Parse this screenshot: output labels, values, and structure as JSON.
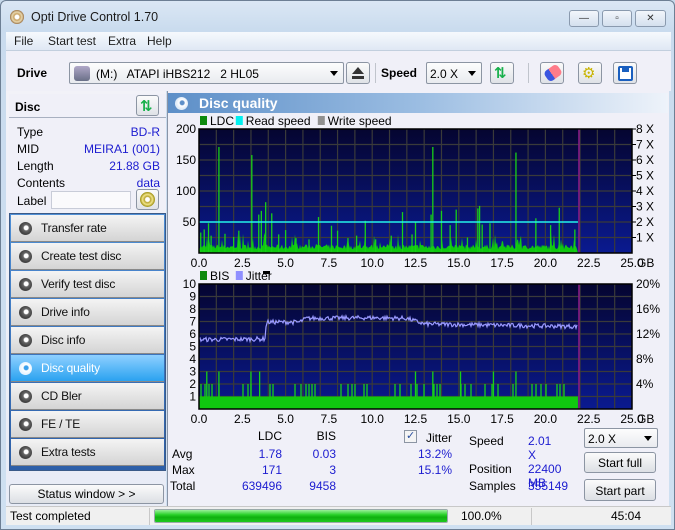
{
  "window": {
    "title": "Opti Drive Control 1.70",
    "controls": {
      "minimize": "—",
      "maximize": "▫",
      "close": "✕"
    }
  },
  "menu": [
    "File",
    "Start test",
    "Extra",
    "Help"
  ],
  "toolbar": {
    "drive_label": "Drive",
    "drive_value": "(M:)   ATAPI iHBS212   2 HL05",
    "speed_label": "Speed",
    "speed_value": "2.0 X"
  },
  "disc": {
    "header": "Disc",
    "fields": [
      {
        "key": "Type",
        "value": "BD-R"
      },
      {
        "key": "MID",
        "value": "MEIRA1 (001)"
      },
      {
        "key": "Length",
        "value": "21.88 GB"
      },
      {
        "key": "Contents",
        "value": "data"
      }
    ],
    "label_key": "Label",
    "label_value": ""
  },
  "nav": {
    "items": [
      {
        "label": "Transfer rate",
        "active": false
      },
      {
        "label": "Create test disc",
        "active": false
      },
      {
        "label": "Verify test disc",
        "active": false
      },
      {
        "label": "Drive info",
        "active": false
      },
      {
        "label": "Disc info",
        "active": false
      },
      {
        "label": "Disc quality",
        "active": true
      },
      {
        "label": "CD Bler",
        "active": false
      },
      {
        "label": "FE / TE",
        "active": false
      },
      {
        "label": "Extra tests",
        "active": false
      }
    ],
    "status_window_button": "Status window > >"
  },
  "panel": {
    "title": "Disc quality"
  },
  "chart_data": [
    {
      "type": "bar",
      "title": "LDC / Read speed",
      "legend": [
        {
          "name": "LDC",
          "color": "#0e8a0e"
        },
        {
          "name": "Read speed",
          "color": "#00f0f0"
        },
        {
          "name": "Write speed",
          "color": "#909090"
        }
      ],
      "xlabel": "GB",
      "x_ticks": [
        "0.0",
        "2.5",
        "5.0",
        "7.5",
        "10.0",
        "12.5",
        "15.0",
        "17.5",
        "20.0",
        "22.5",
        "25.0"
      ],
      "xlim": [
        0,
        25
      ],
      "ylim": [
        0,
        200
      ],
      "y_ticks": [
        "50",
        "100",
        "150",
        "200"
      ],
      "y2_ticks": [
        "1 X",
        "2 X",
        "3 X",
        "4 X",
        "5 X",
        "6 X",
        "7 X",
        "8 X"
      ],
      "y2lim": [
        0,
        8
      ],
      "data_end_gb": 21.88,
      "read_speed_x": 2.0,
      "ldc_spikes": [
        [
          0.1,
          33
        ],
        [
          0.3,
          38
        ],
        [
          0.55,
          48
        ],
        [
          0.7,
          28
        ],
        [
          1.15,
          171
        ],
        [
          1.5,
          31
        ],
        [
          2.0,
          26
        ],
        [
          2.3,
          36
        ],
        [
          3.05,
          158
        ],
        [
          3.45,
          62
        ],
        [
          3.6,
          68
        ],
        [
          3.85,
          82
        ],
        [
          4.2,
          64
        ],
        [
          4.6,
          30
        ],
        [
          5.0,
          37
        ],
        [
          5.6,
          24
        ],
        [
          6.35,
          22
        ],
        [
          6.9,
          58
        ],
        [
          7.65,
          44
        ],
        [
          8.0,
          36
        ],
        [
          8.6,
          24
        ],
        [
          9.1,
          28
        ],
        [
          9.6,
          52
        ],
        [
          10.2,
          22
        ],
        [
          11.1,
          28
        ],
        [
          11.75,
          66
        ],
        [
          12.3,
          30
        ],
        [
          12.5,
          50
        ],
        [
          13.4,
          62
        ],
        [
          13.5,
          171
        ],
        [
          14.0,
          68
        ],
        [
          14.5,
          45
        ],
        [
          14.85,
          70
        ],
        [
          15.5,
          25
        ],
        [
          16.1,
          72
        ],
        [
          16.2,
          76
        ],
        [
          16.35,
          46
        ],
        [
          16.8,
          48
        ],
        [
          18.3,
          162
        ],
        [
          19.45,
          56
        ],
        [
          20.3,
          45
        ],
        [
          20.8,
          73
        ],
        [
          21.7,
          38
        ]
      ],
      "ldc_baseline": 6
    },
    {
      "type": "bar",
      "title": "BIS / Jitter",
      "legend": [
        {
          "name": "BIS",
          "color": "#0e8a0e"
        },
        {
          "name": "Jitter",
          "color": "#8f8fff"
        }
      ],
      "xlabel": "GB",
      "x_ticks": [
        "0.0",
        "2.5",
        "5.0",
        "7.5",
        "10.0",
        "12.5",
        "15.0",
        "17.5",
        "20.0",
        "22.5",
        "25.0"
      ],
      "xlim": [
        0,
        25
      ],
      "ylim": [
        0,
        10
      ],
      "y_ticks": [
        "1",
        "2",
        "3",
        "4",
        "5",
        "6",
        "7",
        "8",
        "9",
        "10"
      ],
      "y2_ticks": [
        "4%",
        "8%",
        "12%",
        "16%",
        "20%"
      ],
      "y2lim": [
        0,
        20
      ],
      "data_end_gb": 21.88,
      "bis_baseline": 1,
      "bis_spikes_3": [
        0.45,
        1.15,
        3.0,
        3.5,
        12.5,
        13.5,
        15.1,
        17.0,
        18.3
      ],
      "jitter_profile": [
        [
          0.0,
          11.1
        ],
        [
          3.8,
          11.2
        ],
        [
          3.9,
          13.9
        ],
        [
          5.8,
          13.9
        ],
        [
          6.2,
          14.5
        ],
        [
          10.0,
          14.6
        ],
        [
          12.0,
          14.5
        ],
        [
          13.0,
          13.6
        ],
        [
          21.88,
          13.2
        ]
      ]
    }
  ],
  "stats": {
    "col_ldc": "LDC",
    "col_bis": "BIS",
    "col_jitter": "Jitter",
    "jitter_checked": true,
    "rows": [
      {
        "label": "Avg",
        "ldc": "1.78",
        "bis": "0.03",
        "jitter": "13.2%"
      },
      {
        "label": "Max",
        "ldc": "171",
        "bis": "3",
        "jitter": "15.1%"
      },
      {
        "label": "Total",
        "ldc": "639496",
        "bis": "9458",
        "jitter": ""
      }
    ],
    "speed_label": "Speed",
    "speed_value": "2.01 X",
    "position_label": "Position",
    "position_value": "22400 MB",
    "samples_label": "Samples",
    "samples_value": "355149",
    "speed_select": "2.0 X",
    "start_full": "Start full",
    "start_part": "Start part"
  },
  "statusbar": {
    "message": "Test completed",
    "progress_percent": 100.0,
    "progress_text": "100.0%",
    "elapsed": "45:04"
  }
}
